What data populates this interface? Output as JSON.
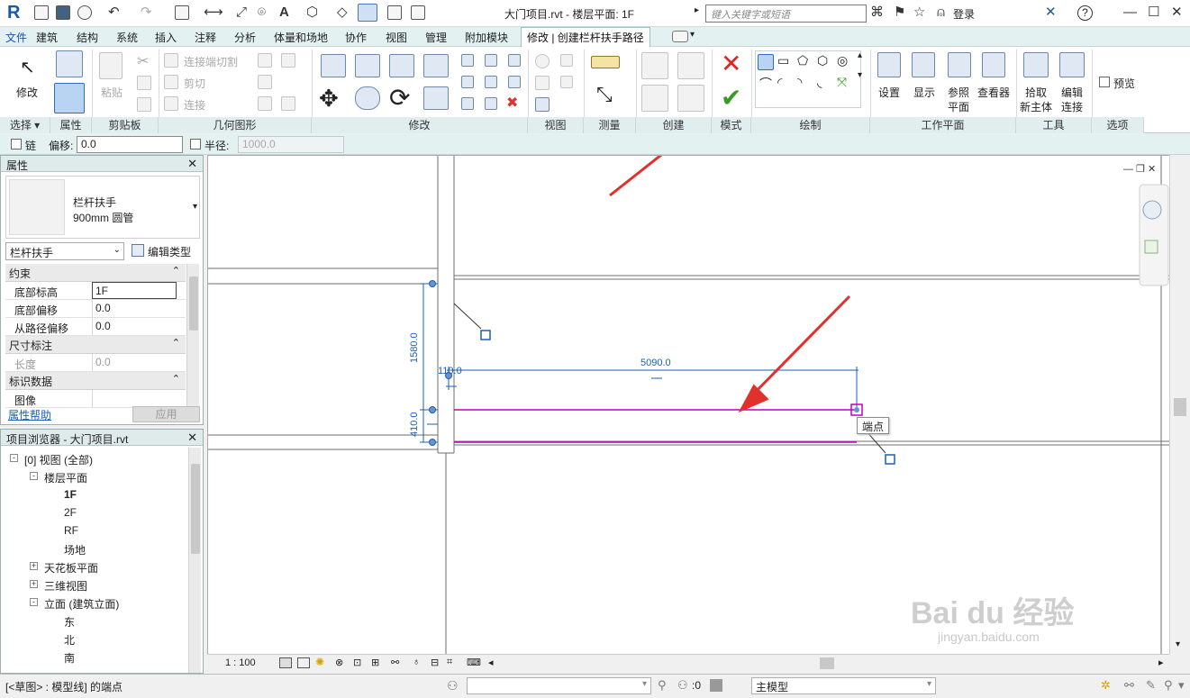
{
  "titlebar": {
    "app_logo": "R",
    "window_title": "大门项目.rvt - 楼层平面: 1F",
    "search_placeholder": "键入关键字或短语",
    "login_label": "登录",
    "help_label": "?",
    "icons": [
      "open-icon",
      "save-icon",
      "sync-icon",
      "undo-icon",
      "redo-icon",
      "print-icon",
      "measure-icon",
      "dimension-icon",
      "tag-icon",
      "text-A-icon",
      "3d-view-icon",
      "section-icon",
      "thin-lines-icon",
      "close-hidden-icon",
      "switch-windows-icon",
      "binoculars-icon",
      "subscription-icon",
      "star-icon",
      "user-icon",
      "exchange-icon",
      "info-icon"
    ]
  },
  "menu": {
    "tabs": [
      "文件",
      "建筑",
      "结构",
      "系统",
      "插入",
      "注释",
      "分析",
      "体量和场地",
      "协作",
      "视图",
      "管理",
      "附加模块",
      "修改 | 创建栏杆扶手路径"
    ],
    "active_index": 12
  },
  "ribbon": {
    "panels": {
      "select": {
        "label": "选择",
        "modify": "修改"
      },
      "properties": {
        "label": "属性"
      },
      "clipboard": {
        "label": "剪贴板",
        "paste": "粘贴"
      },
      "geometry": {
        "label": "几何图形",
        "join_cut": "连接端切割",
        "cut": "剪切",
        "join": "连接"
      },
      "modify": {
        "label": "修改"
      },
      "view": {
        "label": "视图"
      },
      "measure": {
        "label": "测量"
      },
      "create": {
        "label": "创建"
      },
      "mode": {
        "label": "模式"
      },
      "draw": {
        "label": "绘制"
      },
      "workplane": {
        "label": "工作平面",
        "set": "设置",
        "show": "显示",
        "ref_plane_1": "参照",
        "ref_plane_2": "平面",
        "viewer": "查看器"
      },
      "tools": {
        "label": "工具",
        "pick_host_1": "拾取",
        "pick_host_2": "新主体",
        "edit_join_1": "编辑",
        "edit_join_2": "连接"
      },
      "options": {
        "label": "选项",
        "preview": "预览"
      }
    }
  },
  "options_bar": {
    "chain_label": "链",
    "offset_label": "偏移:",
    "offset_value": "0.0",
    "radius_label": "半径:",
    "radius_value": "1000.0"
  },
  "properties": {
    "title": "属性",
    "type_name_1": "栏杆扶手",
    "type_name_2": "900mm 圆管",
    "type_select": "栏杆扶手",
    "edit_type": "编辑类型",
    "groups": [
      {
        "label": "约束",
        "rows": [
          {
            "name": "底部标高",
            "value": "1F"
          },
          {
            "name": "底部偏移",
            "value": "0.0"
          },
          {
            "name": "从路径偏移",
            "value": "0.0"
          }
        ]
      },
      {
        "label": "尺寸标注",
        "rows": [
          {
            "name": "长度",
            "value": "0.0"
          }
        ]
      },
      {
        "label": "标识数据",
        "rows": [
          {
            "name": "图像",
            "value": ""
          }
        ]
      }
    ],
    "help_link": "属性帮助",
    "apply_button": "应用"
  },
  "browser": {
    "title": "项目浏览器 - 大门项目.rvt",
    "items": [
      {
        "label": "[0] 视图 (全部)",
        "level": 0,
        "toggle": "-"
      },
      {
        "label": "楼层平面",
        "level": 1,
        "toggle": "-"
      },
      {
        "label": "1F",
        "level": 2,
        "toggle": ""
      },
      {
        "label": "2F",
        "level": 2,
        "toggle": ""
      },
      {
        "label": "RF",
        "level": 2,
        "toggle": ""
      },
      {
        "label": "场地",
        "level": 2,
        "toggle": ""
      },
      {
        "label": "天花板平面",
        "level": 1,
        "toggle": "+"
      },
      {
        "label": "三维视图",
        "level": 1,
        "toggle": "+"
      },
      {
        "label": "立面 (建筑立面)",
        "level": 1,
        "toggle": "-"
      },
      {
        "label": "东",
        "level": 2,
        "toggle": ""
      },
      {
        "label": "北",
        "level": 2,
        "toggle": ""
      },
      {
        "label": "南",
        "level": 2,
        "toggle": ""
      }
    ]
  },
  "canvas": {
    "dim_vertical_1": "1580.0",
    "dim_vertical_2": "410.0",
    "dim_small": "110.0",
    "dim_horizontal": "5090.0",
    "tooltip_endpoint": "端点",
    "colors": {
      "sketch_line": "#c000c0",
      "dimension": "#1a5fb4",
      "arrow": "#e0312b",
      "wall": "#6e6e6e"
    }
  },
  "view_control": {
    "scale": "1 : 100"
  },
  "statusbar": {
    "message": "[<草图> : 模型线] 的端点",
    "selection_count": ":0",
    "model_label": "主模型"
  },
  "watermark": {
    "brand": "Bai du 经验",
    "url": "jingyan.baidu.com"
  }
}
